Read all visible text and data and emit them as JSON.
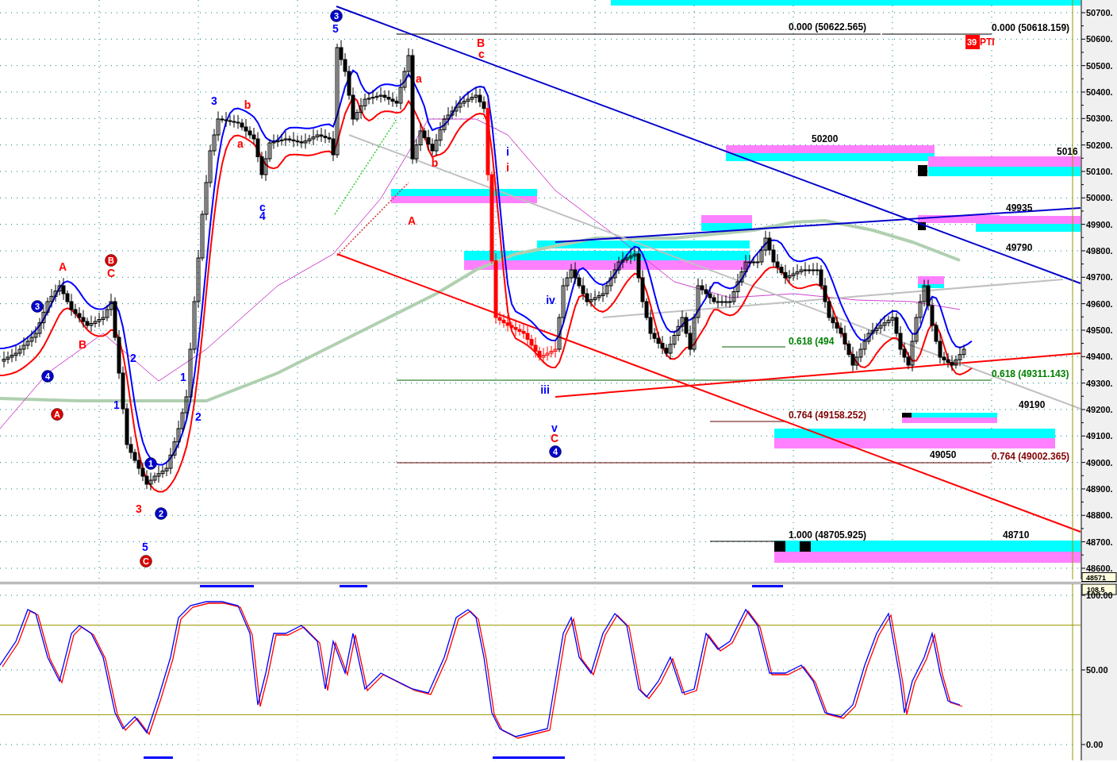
{
  "price_pane": {
    "price_axis": [
      "50700.",
      "50600.",
      "50500.",
      "50400.",
      "50300.",
      "50200.",
      "50100.",
      "50000.",
      "49900.",
      "49800.",
      "49700.",
      "49600.",
      "49500.",
      "49400.",
      "49300.",
      "49200.",
      "49100.",
      "49000.",
      "48900.",
      "48800.",
      "48700.",
      "48600."
    ],
    "last_price": "48571",
    "badge": "39",
    "badge_text": "PTI",
    "fib_labels": [
      {
        "text": "0.000 (50622.565)",
        "color": "#000000"
      },
      {
        "text": "0.000 (50618.159)",
        "color": "#000000"
      },
      {
        "text": "0.618 (494",
        "color": "#008000"
      },
      {
        "text": "0.618 (49311.143)",
        "color": "#008000"
      },
      {
        "text": "0.764 (49158.252)",
        "color": "#800000"
      },
      {
        "text": "0.764 (49002.365)",
        "color": "#800000"
      },
      {
        "text": "1.000 (48705.925)",
        "color": "#000000"
      }
    ],
    "level_labels": [
      "50200",
      "5016",
      "49935",
      "49790",
      "49190",
      "49050",
      "48710"
    ],
    "wave_labels": [
      {
        "text": "3",
        "color": "#0000cc",
        "circled": true
      },
      {
        "text": "5",
        "color": "#0000ff",
        "circled": false
      },
      {
        "text": "B",
        "color": "#ff0000",
        "circled": false
      },
      {
        "text": "c",
        "color": "#ff0000",
        "circled": false
      },
      {
        "text": "a",
        "color": "#ff0000",
        "circled": false
      },
      {
        "text": "3",
        "color": "#0000ff",
        "circled": false
      },
      {
        "text": "b",
        "color": "#ff0000",
        "circled": false
      },
      {
        "text": "a",
        "color": "#ff0000",
        "circled": false
      },
      {
        "text": "i",
        "color": "#0000ff",
        "circled": false
      },
      {
        "text": "b",
        "color": "#ff0000",
        "circled": false
      },
      {
        "text": "i",
        "color": "#ff0000",
        "circled": false
      },
      {
        "text": "c",
        "color": "#0000ff",
        "circled": false
      },
      {
        "text": "4",
        "color": "#0000ff",
        "circled": false
      },
      {
        "text": "A",
        "color": "#ff0000",
        "circled": false
      },
      {
        "text": "B",
        "color": "#dd0000",
        "circled": true
      },
      {
        "text": "A",
        "color": "#ff0000",
        "circled": false
      },
      {
        "text": "C",
        "color": "#ff0000",
        "circled": false
      },
      {
        "text": "iv",
        "color": "#0000ff",
        "circled": false
      },
      {
        "text": "3",
        "color": "#0000cc",
        "circled": true
      },
      {
        "text": "B",
        "color": "#ff0000",
        "circled": false
      },
      {
        "text": "2",
        "color": "#0000ff",
        "circled": false
      },
      {
        "text": "4",
        "color": "#0000cc",
        "circled": true
      },
      {
        "text": "1",
        "color": "#0000ff",
        "circled": false
      },
      {
        "text": "iii",
        "color": "#0000ff",
        "circled": false
      },
      {
        "text": "1",
        "color": "#0000ff",
        "circled": false
      },
      {
        "text": "A",
        "color": "#dd0000",
        "circled": true
      },
      {
        "text": "2",
        "color": "#0000ff",
        "circled": false
      },
      {
        "text": "v",
        "color": "#0000ff",
        "circled": false
      },
      {
        "text": "C",
        "color": "#ff0000",
        "circled": false
      },
      {
        "text": "4",
        "color": "#0000cc",
        "circled": true
      },
      {
        "text": "1",
        "color": "#0000cc",
        "circled": true
      },
      {
        "text": "3",
        "color": "#ff0000",
        "circled": false
      },
      {
        "text": "2",
        "color": "#0000cc",
        "circled": true
      },
      {
        "text": "5",
        "color": "#0000ff",
        "circled": false
      },
      {
        "text": "C",
        "color": "#dd0000",
        "circled": true
      }
    ]
  },
  "oscillator_pane": {
    "top_value": "108.5",
    "axis": [
      "100.00",
      "50.00",
      "0.00"
    ]
  }
}
